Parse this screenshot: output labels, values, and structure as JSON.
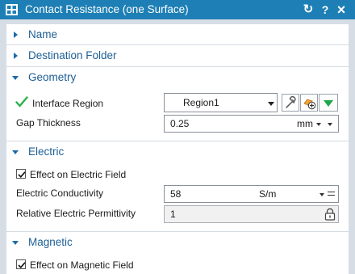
{
  "window": {
    "title": "Contact Resistance (one Surface)",
    "reset_glyph": "↻",
    "help_glyph": "?",
    "close_glyph": "×"
  },
  "sections": {
    "name": {
      "label": "Name",
      "expanded": false
    },
    "destination": {
      "label": "Destination Folder",
      "expanded": false
    },
    "geometry": {
      "label": "Geometry",
      "expanded": true,
      "interface_region": {
        "label": "Interface Region",
        "value": "Region1",
        "status": "valid"
      },
      "gap_thickness": {
        "label": "Gap Thickness",
        "value": "0.25",
        "unit": "mm"
      }
    },
    "electric": {
      "label": "Electric",
      "expanded": true,
      "effect_checkbox": {
        "label": "Effect on Electric Field",
        "checked": true
      },
      "conductivity": {
        "label": "Electric Conductivity",
        "value": "58",
        "unit": "S/m"
      },
      "permittivity": {
        "label": "Relative Electric Permittivity",
        "value": "1",
        "locked": true
      }
    },
    "magnetic": {
      "label": "Magnetic",
      "expanded": true,
      "effect_checkbox": {
        "label": "Effect on Magnetic Field",
        "checked": true
      }
    }
  },
  "icons": {
    "app": "contact-resistance-icon",
    "check": "green-check-icon",
    "wrench": "wrench-icon",
    "select": "select-object-icon",
    "expand": "green-expand-icon",
    "lock": "lock-icon"
  },
  "colors": {
    "titlebar": "#1d7fb5",
    "section_label": "#1d5f95",
    "arrow": "#1d6aa8",
    "check_green": "#2bb24c",
    "background": "#d6dde5"
  }
}
